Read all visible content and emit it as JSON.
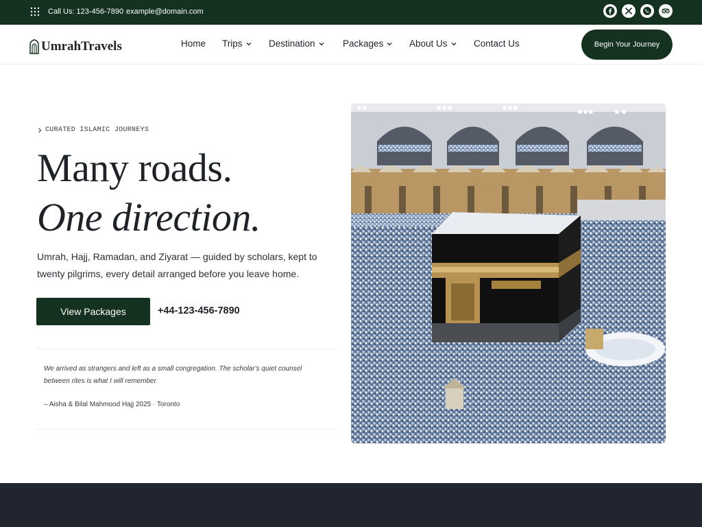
{
  "topbar": {
    "call": "Call Us: 123-456-7890",
    "email": "example@domain.com",
    "socials": [
      "facebook-icon",
      "x-icon",
      "whatsapp-icon",
      "tripadvisor-icon"
    ]
  },
  "header": {
    "logo_text": "UmrahTravels",
    "nav": [
      {
        "label": "Home",
        "dropdown": false
      },
      {
        "label": "Trips",
        "dropdown": true
      },
      {
        "label": "Destination",
        "dropdown": true
      },
      {
        "label": "Packages",
        "dropdown": true
      },
      {
        "label": "About Us",
        "dropdown": true
      },
      {
        "label": "Contact Us",
        "dropdown": false
      }
    ],
    "cta": "Begin Your Journey"
  },
  "hero": {
    "eyebrow": "CURATED ISLAMIC JOURNEYS",
    "title_line1": "Many roads.",
    "title_line2": "One direction.",
    "lede": "Umrah, Hajj, Ramadan, and Ziyarat — guided by scholars, kept to twenty pilgrims, every detail arranged before you leave home.",
    "primary_button": "View Packages",
    "phone": "+44-123-456-7890",
    "quote": "We arrived as strangers and left as a small congregation. The scholar's quiet counsel between rites is what I will remember.",
    "attribution": "– Aisha & Bilal Mahmood Hajj 2025 · Toronto"
  },
  "colors": {
    "brand_green": "#14321f",
    "footer_dark": "#212530",
    "text": "#1f2328"
  }
}
